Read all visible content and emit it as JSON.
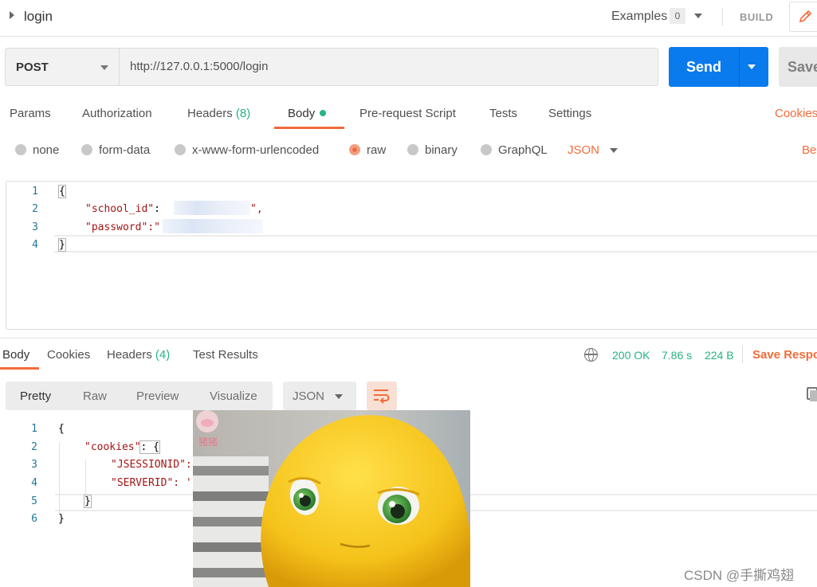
{
  "titlebar": {
    "title": "login",
    "examples_label": "Examples",
    "examples_count": "0",
    "build_label": "BUILD"
  },
  "request": {
    "method": "POST",
    "url": "http://127.0.0.1:5000/login",
    "send_label": "Send",
    "save_label": "Save"
  },
  "request_tabs": {
    "params": "Params",
    "authorization": "Authorization",
    "headers": "Headers",
    "headers_count": "(8)",
    "body": "Body",
    "prerequest": "Pre-request Script",
    "tests": "Tests",
    "settings": "Settings",
    "cookies": "Cookies"
  },
  "body_types": {
    "none": "none",
    "form_data": "form-data",
    "urlencoded": "x-www-form-urlencoded",
    "raw": "raw",
    "binary": "binary",
    "graphql": "GraphQL",
    "language": "JSON",
    "beautify": "Be"
  },
  "request_body": {
    "line_numbers": [
      "1",
      "2",
      "3",
      "4"
    ],
    "open_brace": "{",
    "key_school": "\"school_id\"",
    "colon": ":",
    "quote_end_comma": "\",",
    "key_password": "\"password\"",
    "colon_quote": ":\"",
    "close_brace": "}"
  },
  "response_tabs": {
    "body": "Body",
    "cookies": "Cookies",
    "headers": "Headers",
    "headers_count": "(4)",
    "test_results": "Test Results"
  },
  "response_status": {
    "status": "200 OK",
    "time": "7.86 s",
    "size": "224 B",
    "save_response": "Save Respo"
  },
  "response_view": {
    "pretty": "Pretty",
    "raw": "Raw",
    "preview": "Preview",
    "visualize": "Visualize",
    "format": "JSON"
  },
  "response_body": {
    "line_numbers": [
      "1",
      "2",
      "3",
      "4",
      "5",
      "6"
    ],
    "open_brace": "{",
    "key_cookies": "\"cookies\"",
    "colon_brace": ": {",
    "key_jsession": "\"JSESSIONID\":",
    "key_serverid": "\"SERVERID\": '",
    "inner_close": "}",
    "close_brace": "}"
  },
  "sticker": {
    "logo_text": "猪猪"
  },
  "watermark": "CSDN @手撕鸡翅",
  "colors": {
    "accent": "#f26b3a",
    "send_blue": "#097bed",
    "success": "#26b47f"
  },
  "icons": [
    "caret-right-icon",
    "pencil-icon",
    "globe-icon",
    "wrap-lines-icon",
    "copy-icon"
  ]
}
